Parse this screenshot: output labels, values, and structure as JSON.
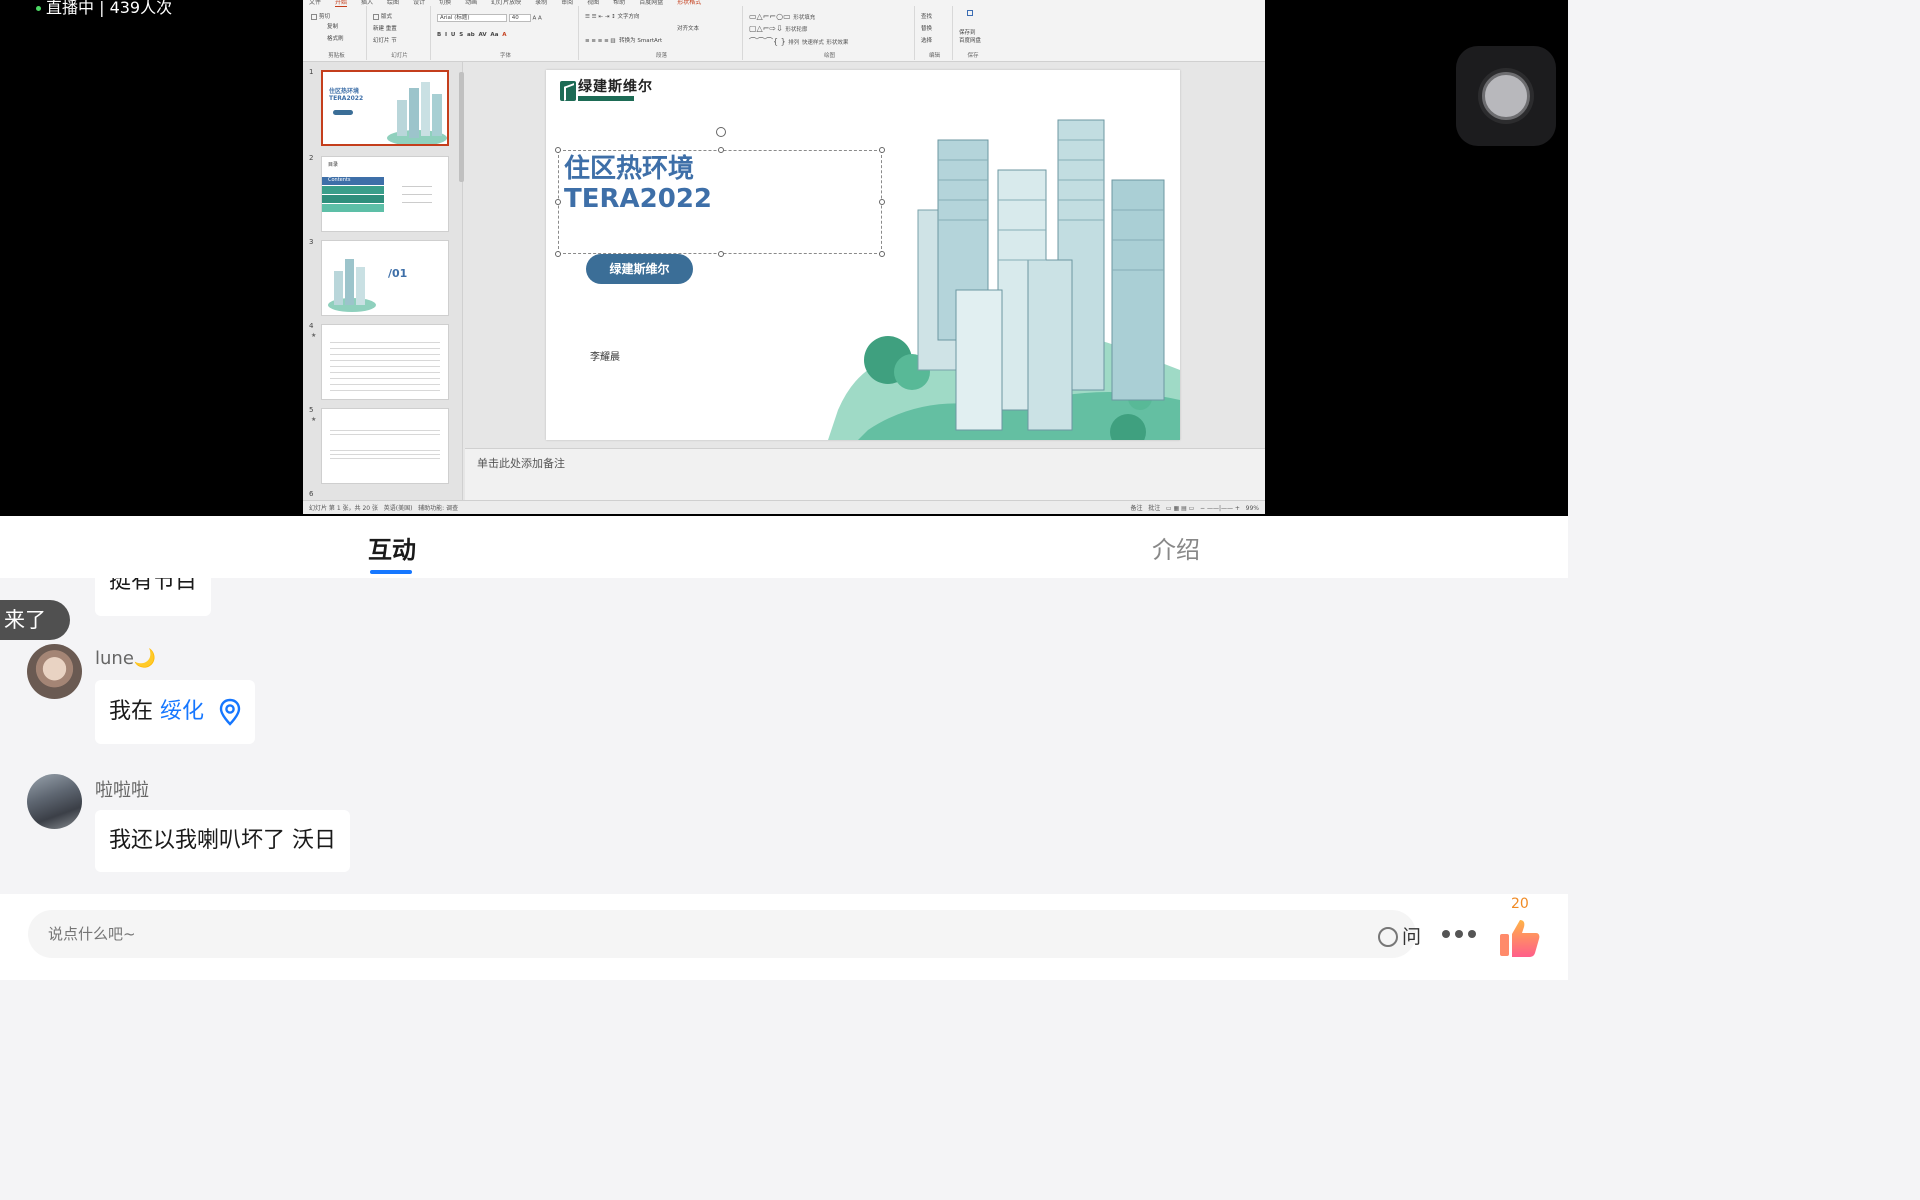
{
  "live": {
    "status_text": "直播中 | 439人次"
  },
  "ppt": {
    "ribbon_tabs": [
      "文件",
      "开始",
      "插入",
      "绘图",
      "设计",
      "切换",
      "动画",
      "幻灯片放映",
      "录制",
      "审阅",
      "视图",
      "帮助",
      "百度网盘",
      "形状格式"
    ],
    "groups": {
      "clipboard": "剪贴板",
      "slides": "幻灯片",
      "font": "字体",
      "paragraph": "段落",
      "drawing": "绘图",
      "editing": "编辑",
      "save": "保存"
    },
    "clipboard_items": [
      "剪切",
      "复制",
      "格式刷"
    ],
    "slides_items": [
      "新建",
      "幻灯片",
      "版式",
      "重置",
      "节"
    ],
    "font_name": "Arial (标题)",
    "font_size": "40",
    "para_items": [
      "文字方向",
      "对齐文本",
      "转换为 SmartArt"
    ],
    "drawing_items": [
      "排列",
      "快速样式",
      "形状填充",
      "形状轮廓",
      "形状效果"
    ],
    "editing_items": [
      "查找",
      "替换",
      "选择"
    ],
    "save_items": [
      "保存到",
      "百度网盘"
    ],
    "thumbnail_numbers": [
      "1",
      "2",
      "3",
      "4",
      "5",
      "6"
    ],
    "thumb_texts": {
      "t1_title": "住区热环境",
      "t1_sub": "TERA2022",
      "t2_title": "目录",
      "t2_contents": "Contents",
      "t3_num": "/01"
    },
    "slide": {
      "logo_text": "绿建斯维尔",
      "title_line1": "住区热环境",
      "title_line2": "TERA2022",
      "pill": "绿建斯维尔",
      "presenter": "李耀晨"
    },
    "notes_placeholder": "单击此处添加备注",
    "status_left": "幻灯片 第 1 张，共 20 张",
    "status_lang": "英语(美国)",
    "status_access": "辅助功能: 调查",
    "status_right_notes": "备注",
    "status_right_comments": "批注",
    "zoom": "99%"
  },
  "tabs": {
    "interact": "互动",
    "intro": "介绍"
  },
  "chat": {
    "toast": "来了",
    "partial_message": "挺有节目",
    "messages": [
      {
        "user": "lune🌙",
        "text_prefix": "我在 ",
        "location": "绥化",
        "icon": "location-pin-icon"
      },
      {
        "user": "啦啦啦",
        "text": "我还以我喇叭坏了 沃日"
      }
    ]
  },
  "input": {
    "placeholder": "说点什么吧~",
    "ask_label": "问",
    "like_count": "20"
  },
  "colors": {
    "accent": "#1677ff",
    "slide_title": "#3e6fa8",
    "pill": "#3b6e97",
    "brand_green": "#1d6b55",
    "like": "#f08a24"
  }
}
